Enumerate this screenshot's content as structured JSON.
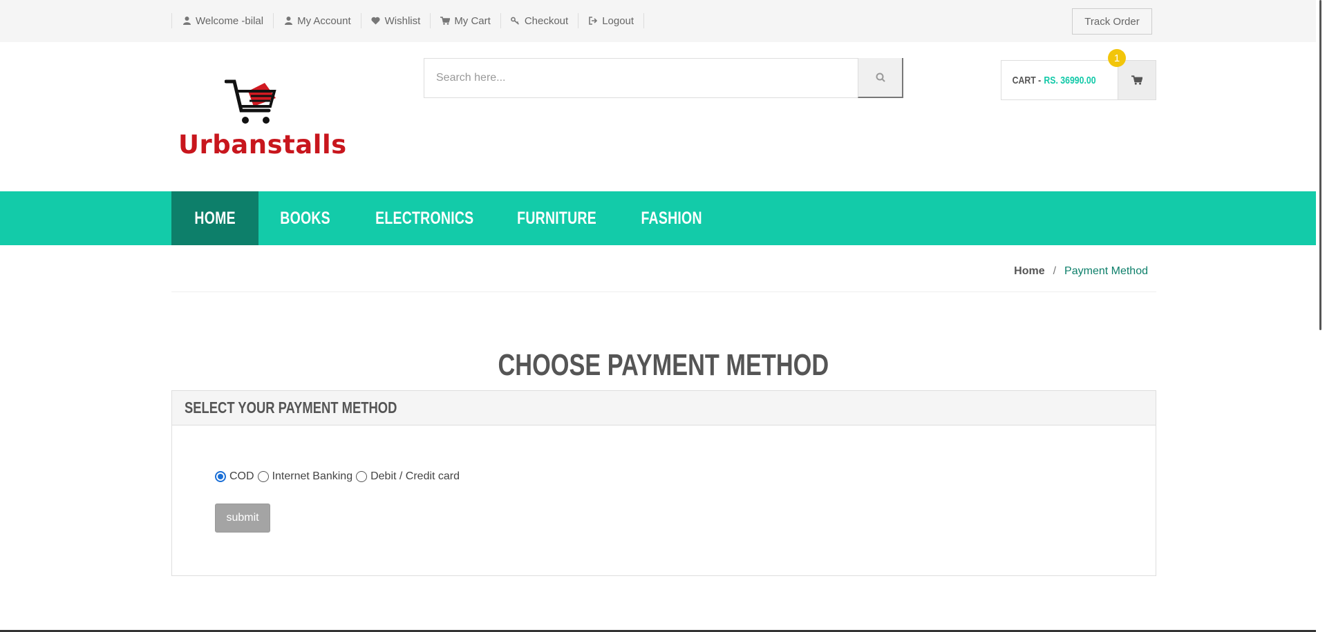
{
  "topbar": {
    "links": [
      {
        "label": "Welcome -bilal",
        "icon": "user-icon"
      },
      {
        "label": "My Account",
        "icon": "user-icon"
      },
      {
        "label": "Wishlist",
        "icon": "heart-icon"
      },
      {
        "label": "My Cart",
        "icon": "cart-icon"
      },
      {
        "label": "Checkout",
        "icon": "key-icon"
      },
      {
        "label": "Logout",
        "icon": "logout-icon"
      }
    ],
    "track_order": "Track Order"
  },
  "header": {
    "logo_text": "Urbanstalls",
    "search_placeholder": "Search here...",
    "cart_label": "CART -",
    "cart_amount": "RS. 36990.00",
    "cart_count": "1"
  },
  "nav": {
    "items": [
      "HOME",
      "BOOKS",
      "ELECTRONICS",
      "FURNITURE",
      "FASHION"
    ]
  },
  "breadcrumb": {
    "home": "Home",
    "separator": "/",
    "current": "Payment Method"
  },
  "page": {
    "title": "CHOOSE PAYMENT METHOD",
    "panel_title": "SELECT YOUR PAYMENT METHOD",
    "options": [
      "COD",
      "Internet Banking",
      "Debit / Credit card"
    ],
    "selected": "COD",
    "submit": "submit"
  },
  "colors": {
    "accent": "#13cba9",
    "accent_dark": "#0d7f6a",
    "logo_red": "#c8161d",
    "badge": "#f2c50a"
  }
}
